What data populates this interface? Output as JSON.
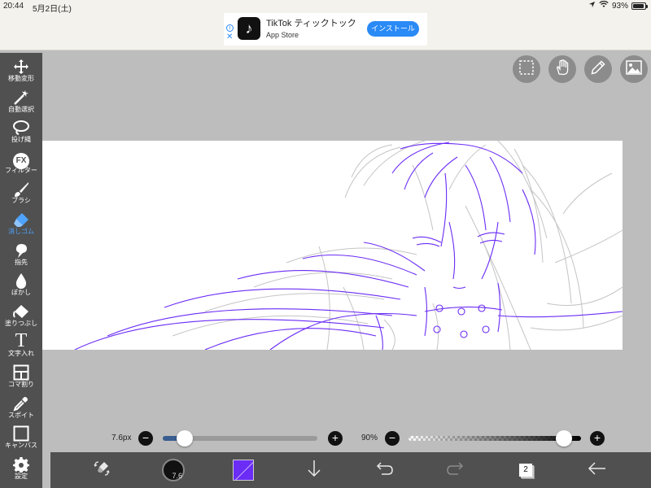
{
  "status_bar": {
    "time": "20:44",
    "date": "5月2日(土)",
    "battery_percent": "93%",
    "battery_level": 0.93
  },
  "ad": {
    "info_glyph": "i",
    "close_glyph": "✕",
    "app_icon": "tiktok-logo-icon",
    "title": "TikTok ティックトック",
    "subtitle": "App Store",
    "install_label": "インストール"
  },
  "tools": [
    {
      "name": "move-transform",
      "label": "移動変形",
      "icon": "move-arrows-icon"
    },
    {
      "name": "auto-select",
      "label": "自動選択",
      "icon": "magic-wand-icon"
    },
    {
      "name": "lasso",
      "label": "投げ縄",
      "icon": "lasso-icon"
    },
    {
      "name": "filter",
      "label": "フィルター",
      "icon": "fx-icon",
      "glyph": "FX"
    },
    {
      "name": "brush",
      "label": "ブラシ",
      "icon": "brush-icon"
    },
    {
      "name": "eraser",
      "label": "消しゴム",
      "icon": "eraser-icon",
      "active": true
    },
    {
      "name": "finger",
      "label": "指先",
      "icon": "finger-smudge-icon"
    },
    {
      "name": "blur",
      "label": "ぼかし",
      "icon": "water-drop-icon"
    },
    {
      "name": "fill",
      "label": "塗りつぶし",
      "icon": "paint-bucket-icon"
    },
    {
      "name": "text",
      "label": "文字入れ",
      "icon": "text-t-icon",
      "glyph": "T"
    },
    {
      "name": "frame-divide",
      "label": "コマ割り",
      "icon": "frame-divide-icon"
    },
    {
      "name": "eyedropper",
      "label": "スポイト",
      "icon": "eyedropper-icon"
    },
    {
      "name": "canvas",
      "label": "キャンバス",
      "icon": "canvas-square-icon"
    },
    {
      "name": "settings",
      "label": "設定",
      "icon": "gear-icon"
    }
  ],
  "top_buttons": [
    {
      "name": "selection-button",
      "icon": "dashed-selection-icon"
    },
    {
      "name": "hand-button",
      "icon": "hand-icon"
    },
    {
      "name": "pen-button",
      "icon": "pen-icon"
    },
    {
      "name": "image-button",
      "icon": "image-icon"
    }
  ],
  "sliders": {
    "size_label": "7.6px",
    "size_level": 0.14,
    "opacity_label": "90%",
    "opacity_level": 0.9,
    "minus_glyph": "−",
    "plus_glyph": "+"
  },
  "bottom_bar": {
    "brush_size_text": "7.6",
    "current_color": "#6b2cf5",
    "layer_count": "2"
  },
  "colors": {
    "panel": "#505050",
    "background": "#bdbdbd",
    "accent": "#4ea3ff",
    "ad_button": "#2a8af6"
  }
}
